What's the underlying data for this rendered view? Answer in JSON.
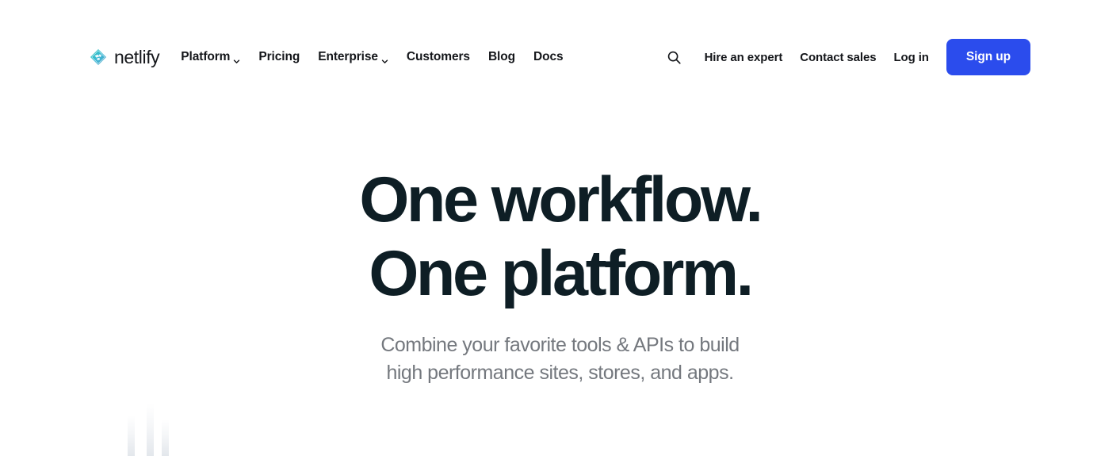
{
  "header": {
    "brand": {
      "name": "netlify",
      "logo_icon": "netlify-diamond-logo",
      "logo_colors": [
        "#00C7B7",
        "#1BBFC4",
        "#4BB9D4"
      ]
    },
    "nav_primary": [
      {
        "label": "Platform",
        "has_dropdown": true,
        "icon": "chevron-down-icon"
      },
      {
        "label": "Pricing",
        "has_dropdown": false,
        "icon": ""
      },
      {
        "label": "Enterprise",
        "has_dropdown": true,
        "icon": "chevron-down-icon"
      },
      {
        "label": "Customers",
        "has_dropdown": false,
        "icon": ""
      },
      {
        "label": "Blog",
        "has_dropdown": false,
        "icon": ""
      },
      {
        "label": "Docs",
        "has_dropdown": false,
        "icon": ""
      }
    ],
    "search": {
      "icon": "search-icon",
      "label": "Search"
    },
    "nav_secondary": [
      {
        "label": "Hire an expert"
      },
      {
        "label": "Contact sales"
      },
      {
        "label": "Log in"
      }
    ],
    "signup": {
      "label": "Sign up",
      "color": "#2b4ced",
      "text_color": "#ffffff"
    }
  },
  "hero": {
    "title_line1": "One workflow.",
    "title_line2": "One platform.",
    "title_color": "#0e1e25",
    "subtitle_line1": "Combine your favorite tools & APIs to build",
    "subtitle_line2": "high performance sites, stores, and apps.",
    "subtitle_color": "#74787e"
  },
  "decoration": {
    "bars_color": "#e3e7ec",
    "bars_count": 3,
    "description": "three faint vertical gradient bars fading upward"
  }
}
